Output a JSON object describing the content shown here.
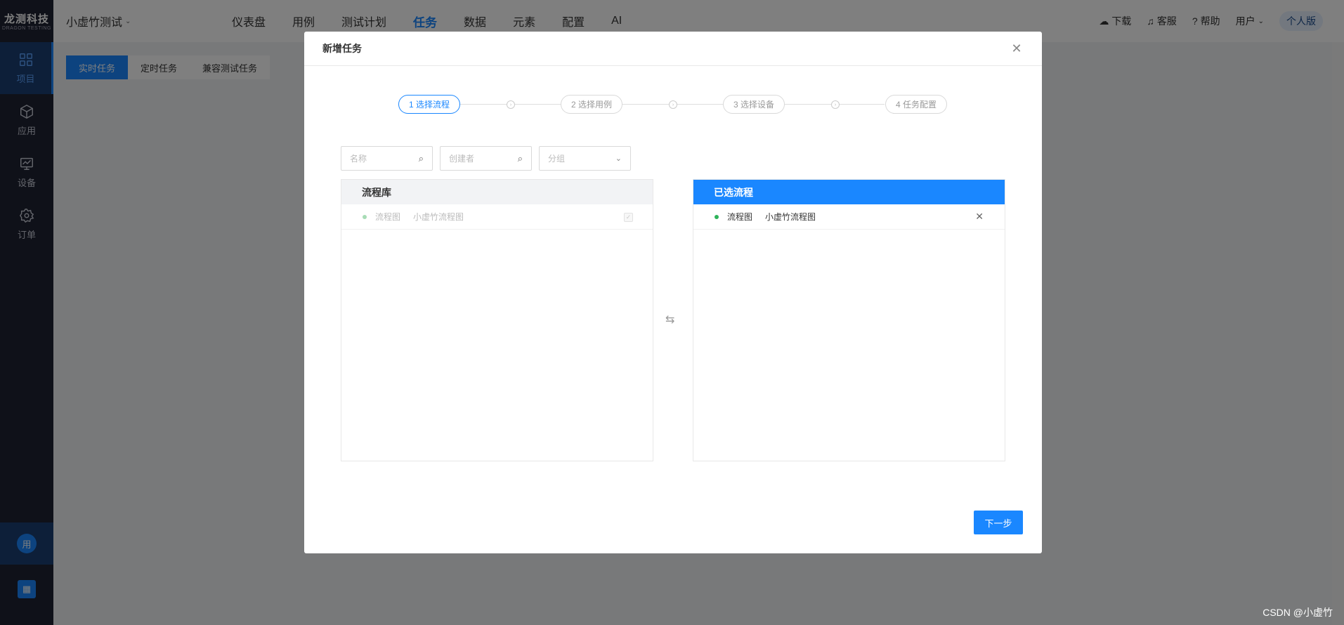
{
  "sidebar": {
    "logo_title": "龙测科技",
    "logo_sub": "DRAGON TESTING",
    "items": [
      {
        "label": "项目",
        "icon": "grid-icon",
        "active": true
      },
      {
        "label": "应用",
        "icon": "cube-icon",
        "active": false
      },
      {
        "label": "设备",
        "icon": "monitor-icon",
        "active": false
      },
      {
        "label": "订单",
        "icon": "gear-icon",
        "active": false
      }
    ],
    "avatar_text": "用",
    "building_icon_text": "▦"
  },
  "header": {
    "project": "小虚竹测试",
    "nav": [
      "仪表盘",
      "用例",
      "测试计划",
      "任务",
      "数据",
      "元素",
      "配置",
      "AI"
    ],
    "active_nav": "任务",
    "right": {
      "download": "下载",
      "service": "客服",
      "help": "帮助",
      "user": "用户",
      "plan": "个人版"
    }
  },
  "subtabs": [
    "实时任务",
    "定时任务",
    "兼容测试任务"
  ],
  "modal": {
    "title": "新增任务",
    "steps": [
      "1 选择流程",
      "2 选择用例",
      "3 选择设备",
      "4 任务配置"
    ],
    "active_step": 0,
    "filters": {
      "name_placeholder": "名称",
      "creator_placeholder": "创建者",
      "group_placeholder": "分组"
    },
    "left_panel": {
      "title": "流程库",
      "rows": [
        {
          "type": "流程图",
          "name": "小虚竹流程图"
        }
      ]
    },
    "right_panel": {
      "title": "已选流程",
      "rows": [
        {
          "type": "流程图",
          "name": "小虚竹流程图"
        }
      ]
    },
    "next_label": "下一步"
  },
  "watermark": "CSDN @小虚竹",
  "colors": {
    "accent": "#1a87ff",
    "sidebar": "#1f2233"
  }
}
